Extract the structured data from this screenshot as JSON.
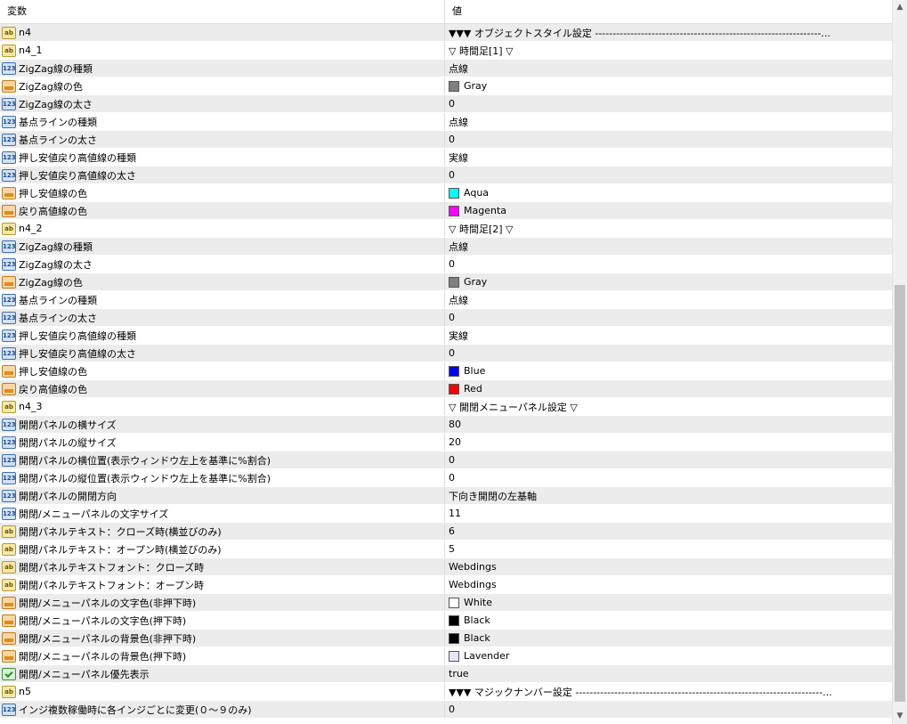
{
  "header": {
    "col_name": "変数",
    "col_value": "値"
  },
  "rows": [
    {
      "icon": "ab",
      "name": "n4",
      "value": "▼▼▼ オブジェクトスタイル設定 ----------------------------------------------------------------..."
    },
    {
      "icon": "ab",
      "name": "n4_1",
      "value": "▽ 時間足[1] ▽"
    },
    {
      "icon": "num",
      "name": "ZigZag線の種類",
      "value": "点線"
    },
    {
      "icon": "col",
      "name": "ZigZag線の色",
      "value": "Gray",
      "swatch": "#808080"
    },
    {
      "icon": "num",
      "name": "ZigZag線の太さ",
      "value": "0"
    },
    {
      "icon": "num",
      "name": "基点ラインの種類",
      "value": "点線"
    },
    {
      "icon": "num",
      "name": "基点ラインの太さ",
      "value": "0"
    },
    {
      "icon": "num",
      "name": "押し安値戻り高値線の種類",
      "value": "実線"
    },
    {
      "icon": "num",
      "name": "押し安値戻り高値線の太さ",
      "value": "0"
    },
    {
      "icon": "col",
      "name": "押し安値線の色",
      "value": "Aqua",
      "swatch": "#00ffff"
    },
    {
      "icon": "col",
      "name": "戻り高値線の色",
      "value": "Magenta",
      "swatch": "#ff00ff"
    },
    {
      "icon": "ab",
      "name": "n4_2",
      "value": "▽ 時間足[2] ▽"
    },
    {
      "icon": "num",
      "name": "ZigZag線の種類",
      "value": "点線"
    },
    {
      "icon": "num",
      "name": "ZigZag線の太さ",
      "value": "0"
    },
    {
      "icon": "col",
      "name": "ZigZag線の色",
      "value": "Gray",
      "swatch": "#808080"
    },
    {
      "icon": "num",
      "name": "基点ラインの種類",
      "value": "点線"
    },
    {
      "icon": "num",
      "name": "基点ラインの太さ",
      "value": "0"
    },
    {
      "icon": "num",
      "name": "押し安値戻り高値線の種類",
      "value": "実線"
    },
    {
      "icon": "num",
      "name": "押し安値戻り高値線の太さ",
      "value": "0"
    },
    {
      "icon": "col",
      "name": "押し安値線の色",
      "value": "Blue",
      "swatch": "#0000ff"
    },
    {
      "icon": "col",
      "name": "戻り高値線の色",
      "value": "Red",
      "swatch": "#ff0000"
    },
    {
      "icon": "ab",
      "name": "n4_3",
      "value": "▽ 開閉メニューパネル設定 ▽"
    },
    {
      "icon": "num",
      "name": "開閉パネルの横サイズ",
      "value": "80"
    },
    {
      "icon": "num",
      "name": "開閉パネルの縦サイズ",
      "value": "20"
    },
    {
      "icon": "num",
      "name": "開閉パネルの横位置(表示ウィンドウ左上を基準に%割合)",
      "value": "0"
    },
    {
      "icon": "num",
      "name": "開閉パネルの縦位置(表示ウィンドウ左上を基準に%割合)",
      "value": "0"
    },
    {
      "icon": "num",
      "name": "開閉パネルの開閉方向",
      "value": "下向き開閉の左基軸"
    },
    {
      "icon": "num",
      "name": "開閉/メニューパネルの文字サイズ",
      "value": "11"
    },
    {
      "icon": "ab",
      "name": "開閉パネルテキスト：クローズ時(横並びのみ)",
      "value": "6"
    },
    {
      "icon": "ab",
      "name": "開閉パネルテキスト：オープン時(横並びのみ)",
      "value": "5"
    },
    {
      "icon": "ab",
      "name": "開閉パネルテキストフォント：クローズ時",
      "value": "Webdings"
    },
    {
      "icon": "ab",
      "name": "開閉パネルテキストフォント：オープン時",
      "value": "Webdings"
    },
    {
      "icon": "col",
      "name": "開閉/メニューパネルの文字色(非押下時)",
      "value": "White",
      "swatch": "#ffffff"
    },
    {
      "icon": "col",
      "name": "開閉/メニューパネルの文字色(押下時)",
      "value": "Black",
      "swatch": "#000000"
    },
    {
      "icon": "col",
      "name": "開閉/メニューパネルの背景色(非押下時)",
      "value": "Black",
      "swatch": "#000000"
    },
    {
      "icon": "col",
      "name": "開閉/メニューパネルの背景色(押下時)",
      "value": "Lavender",
      "swatch": "#e6e6fa"
    },
    {
      "icon": "bool",
      "name": "開閉/メニューパネル優先表示",
      "value": "true"
    },
    {
      "icon": "ab",
      "name": "n5",
      "value": "▼▼▼ マジックナンバー設定 ----------------------------------------------------------------------..."
    },
    {
      "icon": "num",
      "name": "インジ複数稼働時に各インジごとに変更(０～９のみ)",
      "value": "0"
    }
  ],
  "icons": {
    "ab": {
      "label": "ab",
      "name": "string-type-icon"
    },
    "num": {
      "label": "123",
      "name": "integer-type-icon"
    },
    "col": {
      "label": "",
      "name": "color-type-icon"
    },
    "bool": {
      "label": "",
      "name": "bool-type-icon"
    }
  },
  "scrollbar": {
    "up": "▲",
    "down": "▼"
  }
}
